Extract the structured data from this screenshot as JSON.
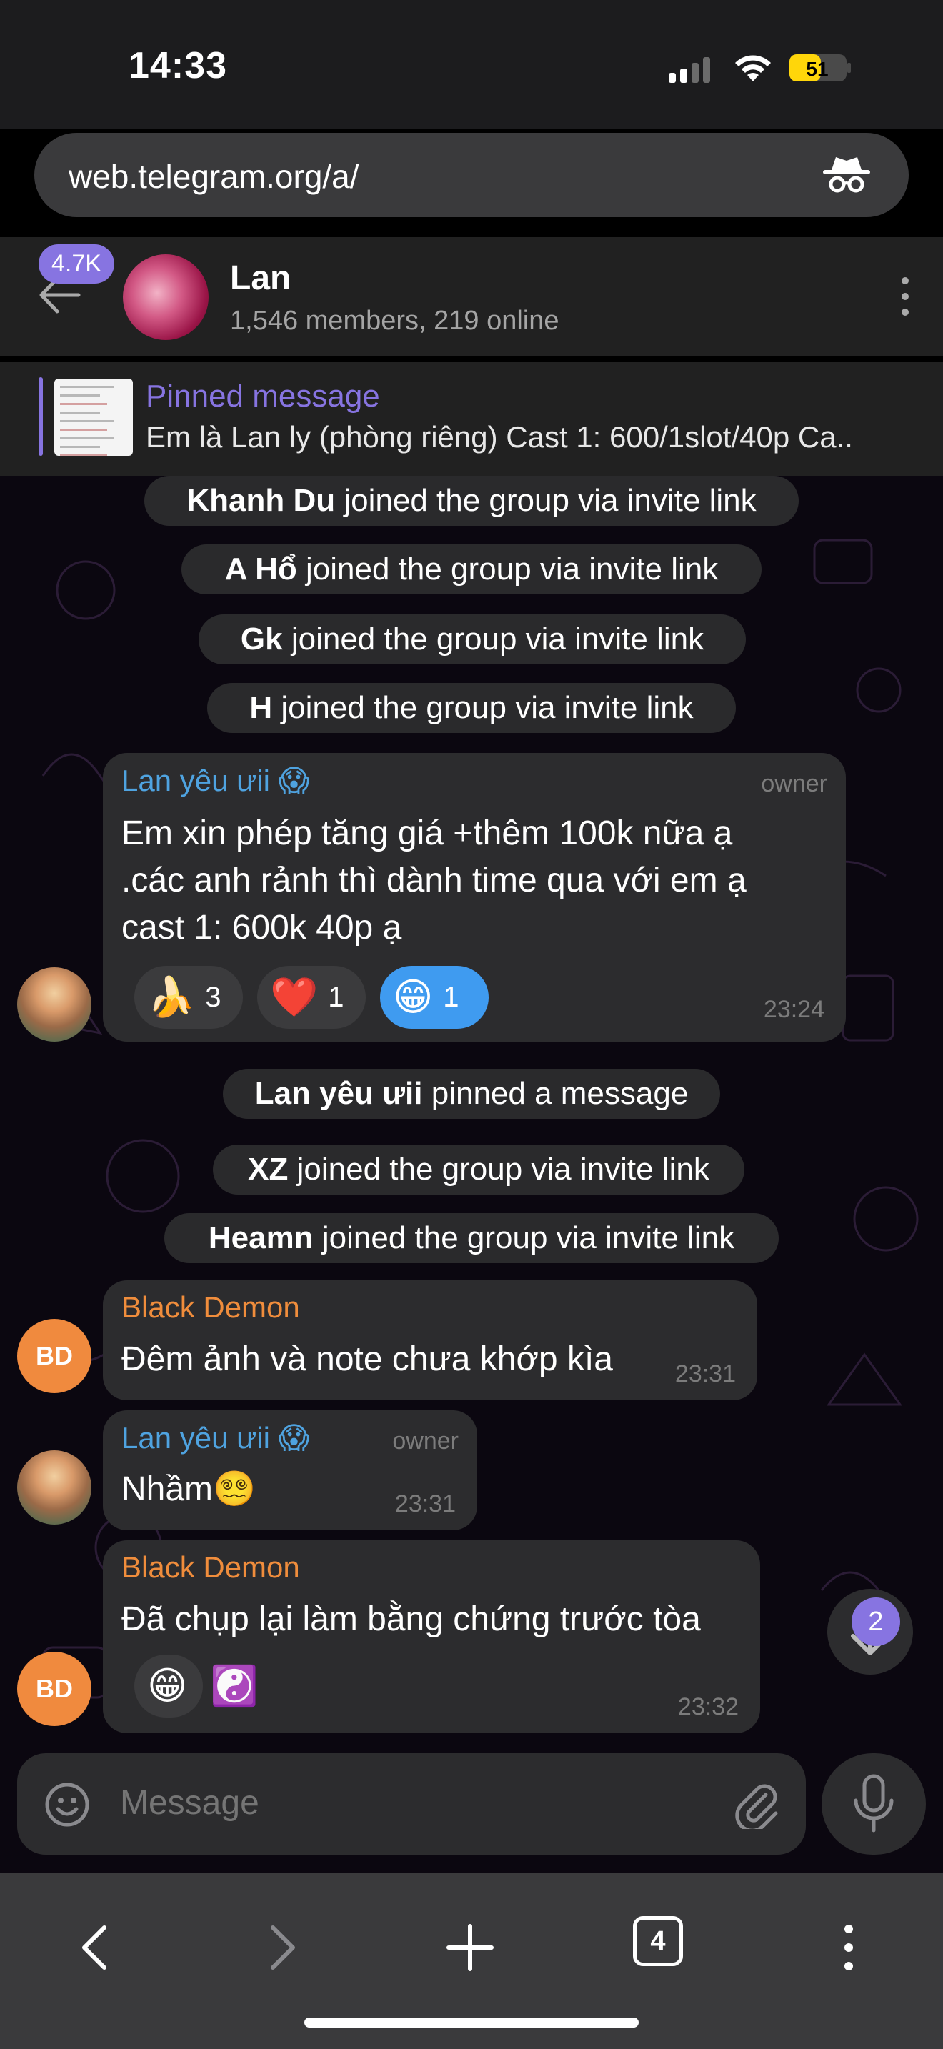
{
  "status": {
    "time": "14:33",
    "battery": "51"
  },
  "browser": {
    "url": "web.telegram.org/a/",
    "tab_count": "4"
  },
  "header": {
    "unread_badge": "4.7K",
    "title": "Lan",
    "subtitle": "1,546 members, 219 online"
  },
  "pinned": {
    "label": "Pinned message",
    "text": "Em là Lan ly (phòng riêng) Cast 1: 600/1slot/40p Ca.."
  },
  "events": [
    {
      "name": "Khanh Du",
      "action": " joined the group via invite link"
    },
    {
      "name": "A Hổ",
      "action": " joined the group via invite link"
    },
    {
      "name": "Gk",
      "action": " joined the group via invite link"
    },
    {
      "name": "H",
      "action": " joined the group via invite link"
    },
    {
      "name": "Lan yêu ưii",
      "action": " pinned a message"
    },
    {
      "name": "XZ",
      "action": " joined the group via invite link"
    },
    {
      "name": "Heamn",
      "action": " joined the group via invite link"
    }
  ],
  "messages": [
    {
      "sender": "Lan yêu ưii 😱",
      "role": "owner",
      "lines": [
        "Em xin phép tăng giá +thêm 100k nữa ạ",
        ".các anh rảnh thì dành time qua với em ạ",
        "cast 1: 600k 40p ạ"
      ],
      "time": "23:24",
      "reactions": [
        {
          "emoji": "🍌",
          "count": "3"
        },
        {
          "emoji": "❤️",
          "count": "1"
        },
        {
          "emoji": "😁",
          "count": "1",
          "active": true
        }
      ]
    },
    {
      "sender": "Black Demon",
      "avatar_initials": "BD",
      "lines": [
        "Đêm ảnh và note chưa khớp kìa"
      ],
      "time": "23:31"
    },
    {
      "sender": "Lan yêu ưii 😱",
      "role": "owner",
      "lines": [
        "Nhầm😵‍💫"
      ],
      "time": "23:31"
    },
    {
      "sender": "Black Demon",
      "avatar_initials": "BD",
      "lines": [
        "Đã chụp lại làm bằng chứng trước tòa"
      ],
      "time": "23:32",
      "reactions": [
        {
          "emoji": "😁",
          "count": ""
        },
        {
          "emoji": "☯️",
          "count": ""
        }
      ]
    }
  ],
  "scroll_badge": "2",
  "composer": {
    "placeholder": "Message"
  },
  "colors": {
    "accent": "#8774e1",
    "owner_name": "#4fa3e0",
    "member_name": "#f08d3c",
    "reaction_active": "#3f9bf0"
  }
}
